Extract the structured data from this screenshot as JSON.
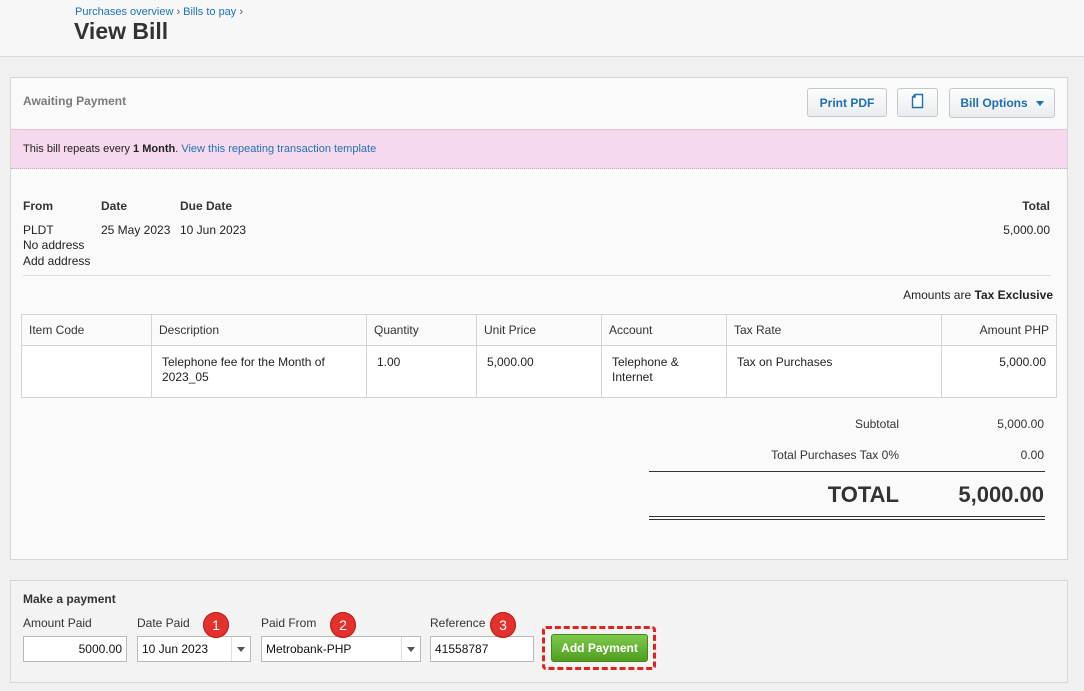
{
  "breadcrumb": {
    "items": [
      "Purchases overview",
      "Bills to pay"
    ],
    "separator": "›"
  },
  "page_title": "View Bill",
  "bill": {
    "status": "Awaiting Payment",
    "buttons": {
      "print_pdf": "Print PDF",
      "copy_icon": "copy-document-icon",
      "bill_options": "Bill Options"
    },
    "repeat_banner": {
      "prefix": "This bill repeats every ",
      "period": "1 Month",
      "suffix": ". ",
      "link": "View this repeating transaction template"
    },
    "headers": {
      "from": "From",
      "date": "Date",
      "due_date": "Due Date",
      "total": "Total"
    },
    "from_name": "PLDT",
    "no_address": "No address",
    "add_address": "Add address",
    "date": "25 May 2023",
    "due_date": "10 Jun 2023",
    "total": "5,000.00",
    "amounts_are_label": "Amounts are",
    "amounts_are_value": "Tax Exclusive"
  },
  "items_table": {
    "columns": [
      "Item Code",
      "Description",
      "Quantity",
      "Unit Price",
      "Account",
      "Tax Rate",
      "Amount PHP"
    ],
    "rows": [
      {
        "item_code": "",
        "description": "Telephone fee for the Month of 2023_05",
        "quantity": "1.00",
        "unit_price": "5,000.00",
        "account": "Telephone & Internet",
        "tax_rate": "Tax on Purchases",
        "amount": "5,000.00"
      }
    ]
  },
  "totals": {
    "subtotal_label": "Subtotal",
    "subtotal": "5,000.00",
    "tax_label": "Total Purchases Tax 0%",
    "tax": "0.00",
    "total_label": "TOTAL",
    "total": "5,000.00"
  },
  "payment": {
    "title": "Make a payment",
    "amount_label": "Amount Paid",
    "amount_value": "5000.00",
    "date_label": "Date Paid",
    "date_value": "10 Jun 2023",
    "from_label": "Paid From",
    "from_value": "Metrobank-PHP",
    "reference_label": "Reference",
    "reference_value": "41558787",
    "add_button": "Add Payment",
    "badges": [
      "1",
      "2",
      "3"
    ]
  },
  "colors": {
    "link": "#1f73b7",
    "banner_bg": "#f6d9ec",
    "add_button": "#5aad2a",
    "badge": "#e3322d",
    "highlight_border": "#e0231e"
  }
}
